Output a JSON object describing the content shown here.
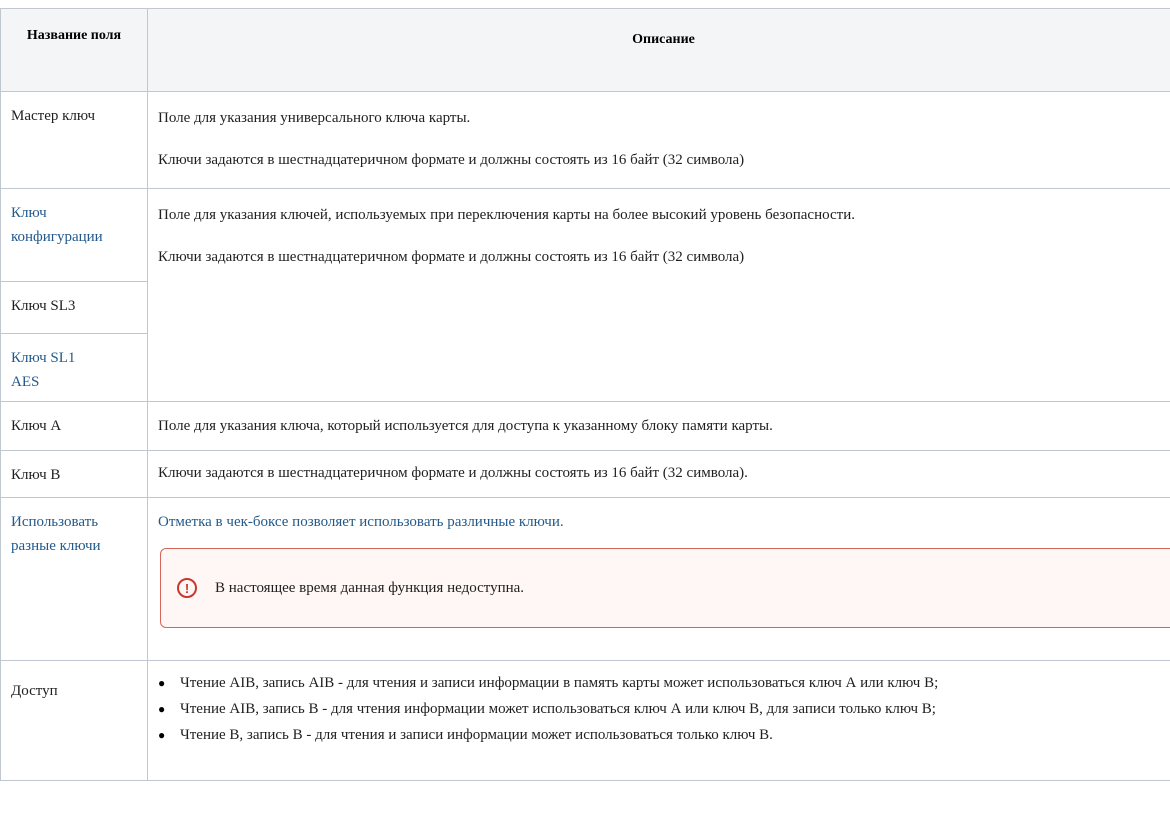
{
  "table": {
    "headers": [
      "Название поля",
      "Описание"
    ],
    "rows": {
      "master_key": {
        "field": "Мастер ключ",
        "desc": [
          "Поле для указания универсального ключа карты.",
          "Ключи задаются в шестнадцатеричном формате и должны состоять из 16 байт (32 символа)"
        ]
      },
      "config_key": {
        "field": "Ключ конфигурации",
        "desc": [
          "Поле для указания ключей, используемых при переключения карты на более высокий уровень безопасности.",
          "Ключи задаются в шестнадцатеричном формате и должны состоять из 16 байт (32 символа)"
        ]
      },
      "sl3_key": {
        "field": "Ключ SL3"
      },
      "sl1_aes_key": {
        "field": "Ключ SL1 AES"
      },
      "key_a": {
        "field": "Ключ А",
        "desc": "Поле для указания ключа, который используется для доступа к указанному блоку памяти карты."
      },
      "key_b": {
        "field": "Ключ В",
        "desc": "Ключи задаются в шестнадцатеричном формате и должны состоять из 16 байт (32 символа)."
      },
      "different_keys": {
        "field": "Использовать разные ключи",
        "desc": "Отметка в чек-боксе позволяет использовать различные ключи.",
        "warning": "В настоящее время данная функция недоступна.",
        "warning_icon": "exclamation-circle-icon"
      },
      "access": {
        "field": "Доступ",
        "items": [
          "Чтение AIB, запись AIB - для чтения и записи информации в память карты может использоваться ключ А или ключ В;",
          "Чтение AIB, запись В - для чтения информации может использоваться ключ А или ключ В, для записи только ключ В;",
          "Чтение В, запись В - для чтения и записи информации может использоваться только ключ В."
        ]
      }
    }
  }
}
